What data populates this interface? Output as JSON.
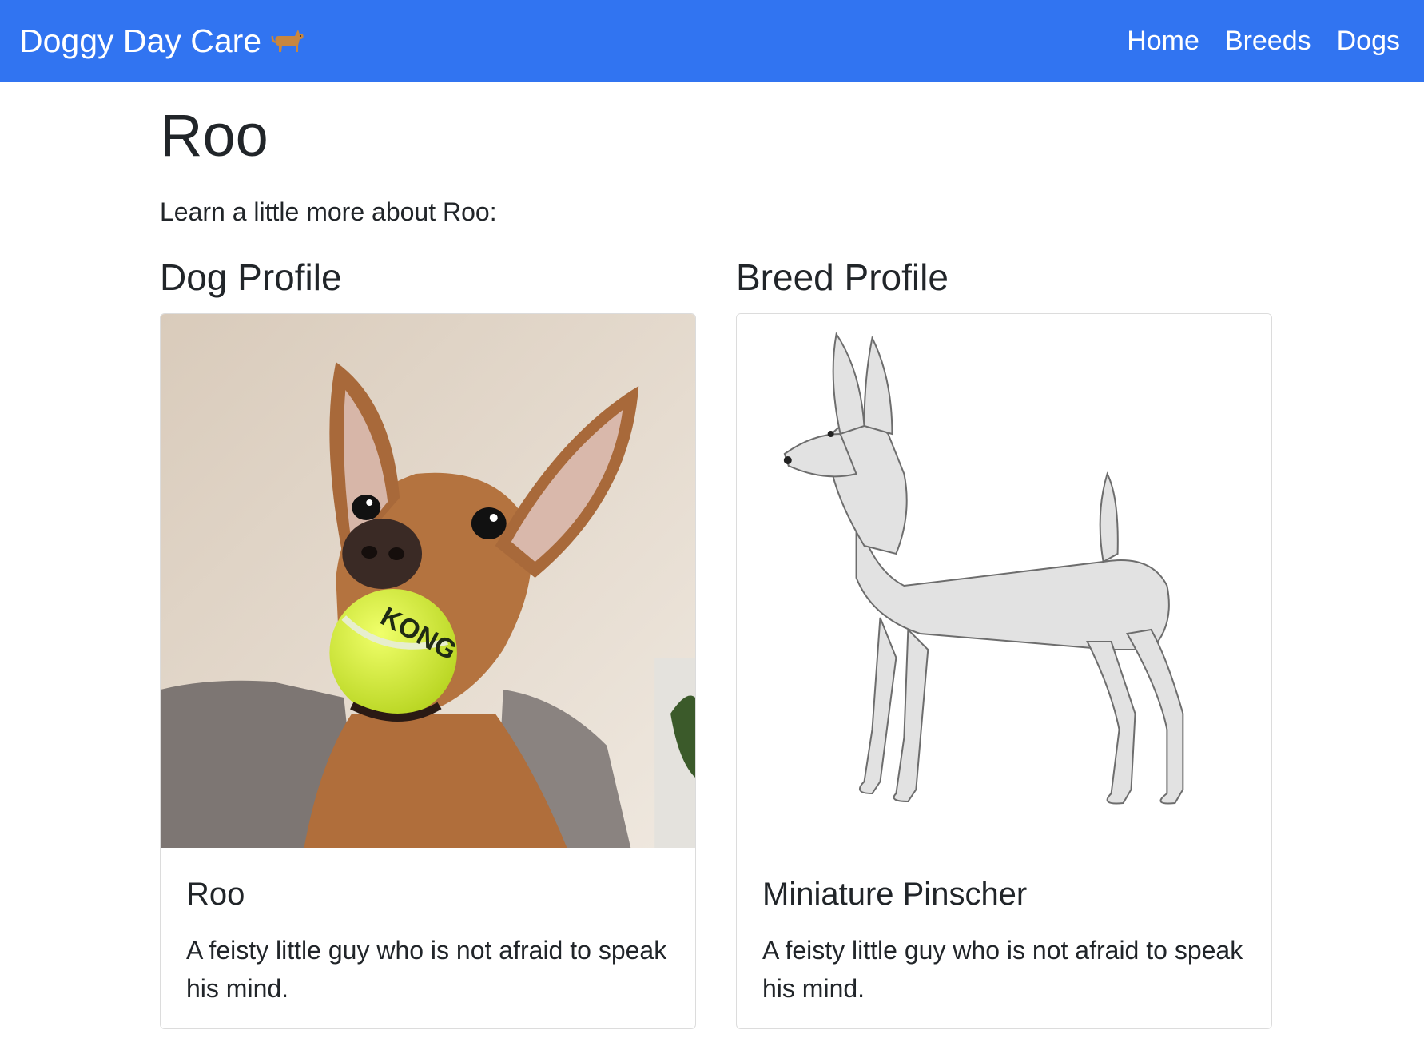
{
  "navbar": {
    "brand": "Doggy Day Care",
    "brand_icon": "dog-icon",
    "links": [
      "Home",
      "Breeds",
      "Dogs"
    ],
    "background": "#3174f1"
  },
  "page": {
    "title": "Roo",
    "intro": "Learn a little more about Roo:"
  },
  "dog_profile": {
    "heading": "Dog Profile",
    "image": "dog-photo",
    "name": "Roo",
    "description": "A feisty little guy who is not afraid to speak his mind."
  },
  "breed_profile": {
    "heading": "Breed Profile",
    "image": "breed-illustration",
    "name": "Miniature Pinscher",
    "description": "A feisty little guy who is not afraid to speak his mind."
  }
}
